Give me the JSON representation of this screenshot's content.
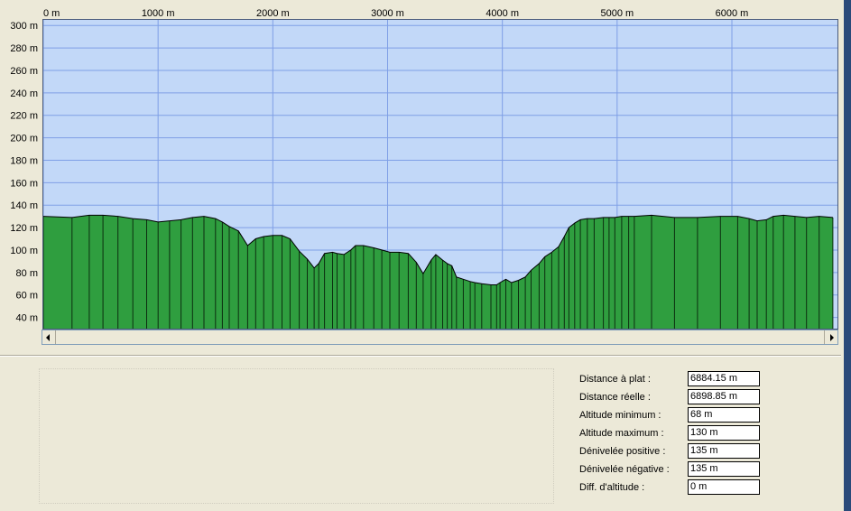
{
  "chart_data": {
    "type": "area",
    "title": "",
    "xlabel": "",
    "ylabel": "",
    "x_unit": "m",
    "y_unit": "m",
    "xlim": [
      0,
      6920
    ],
    "ylim": [
      30,
      305
    ],
    "x_ticks": [
      0,
      1000,
      2000,
      3000,
      4000,
      5000,
      6000
    ],
    "x_tick_labels": [
      "0 m",
      "1000 m",
      "2000 m",
      "3000 m",
      "4000 m",
      "5000 m",
      "6000 m"
    ],
    "y_ticks": [
      40,
      60,
      80,
      100,
      120,
      140,
      160,
      180,
      200,
      220,
      240,
      260,
      280,
      300
    ],
    "y_tick_labels": [
      "40 m",
      "60 m",
      "80 m",
      "100 m",
      "120 m",
      "140 m",
      "160 m",
      "180 m",
      "200 m",
      "220 m",
      "240 m",
      "260 m",
      "280 m",
      "300 m"
    ],
    "grid": true,
    "legend": "none",
    "colors": {
      "fill": "#2f9e3f",
      "sky": "#c2d8f8",
      "grid": "#7f9fe6",
      "outline": "#000000"
    },
    "series": [
      {
        "x": [
          0,
          250,
          400,
          520,
          650,
          780,
          900,
          1000,
          1100,
          1200,
          1300,
          1400,
          1500,
          1560,
          1620,
          1700,
          1780,
          1850,
          1920,
          2000,
          2080,
          2150,
          2230,
          2300,
          2360,
          2400,
          2450,
          2520,
          2560,
          2620,
          2680,
          2720,
          2790,
          2880,
          2950,
          3020,
          3100,
          3180,
          3250,
          3310,
          3380,
          3420,
          3480,
          3520,
          3560,
          3600,
          3660,
          3720,
          3760,
          3820,
          3900,
          3950,
          3980,
          4030,
          4080,
          4140,
          4200,
          4250,
          4320,
          4370,
          4430,
          4490,
          4540,
          4580,
          4630,
          4680,
          4740,
          4800,
          4880,
          4930,
          4980,
          5040,
          5100,
          5150,
          5300,
          5500,
          5700,
          5900,
          6050,
          6150,
          6220,
          6300,
          6360,
          6450,
          6550,
          6650,
          6760,
          6880
        ],
        "y": [
          130,
          129,
          131,
          131,
          130,
          128,
          127,
          125,
          126,
          127,
          129,
          130,
          128,
          125,
          121,
          117,
          104,
          110,
          112,
          113,
          113,
          110,
          99,
          92,
          84,
          88,
          97,
          98,
          97,
          96,
          100,
          104,
          104,
          102,
          100,
          98,
          98,
          97,
          89,
          79,
          91,
          96,
          91,
          88,
          86,
          76,
          74,
          72,
          71,
          70,
          69,
          69,
          71,
          74,
          71,
          73,
          76,
          82,
          88,
          94,
          98,
          103,
          112,
          120,
          124,
          127,
          128,
          128,
          129,
          129,
          129,
          130,
          130,
          130,
          131,
          129,
          129,
          130,
          130,
          128,
          126,
          127,
          130,
          131,
          130,
          129,
          130,
          129
        ]
      }
    ]
  },
  "stats": [
    {
      "label": "Distance à plat :",
      "value": "6884.15 m"
    },
    {
      "label": "Distance réelle :",
      "value": "6898.85 m"
    },
    {
      "label": "Altitude minimum :",
      "value": "68 m"
    },
    {
      "label": "Altitude maximum :",
      "value": "130 m"
    },
    {
      "label": "Dénivelée positive :",
      "value": "135 m"
    },
    {
      "label": "Dénivelée négative :",
      "value": "135 m"
    },
    {
      "label": "Diff. d'altitude :",
      "value": "0 m"
    }
  ],
  "scrollbar": {
    "left_icon": "arrow-left-icon",
    "right_icon": "arrow-right-icon"
  }
}
